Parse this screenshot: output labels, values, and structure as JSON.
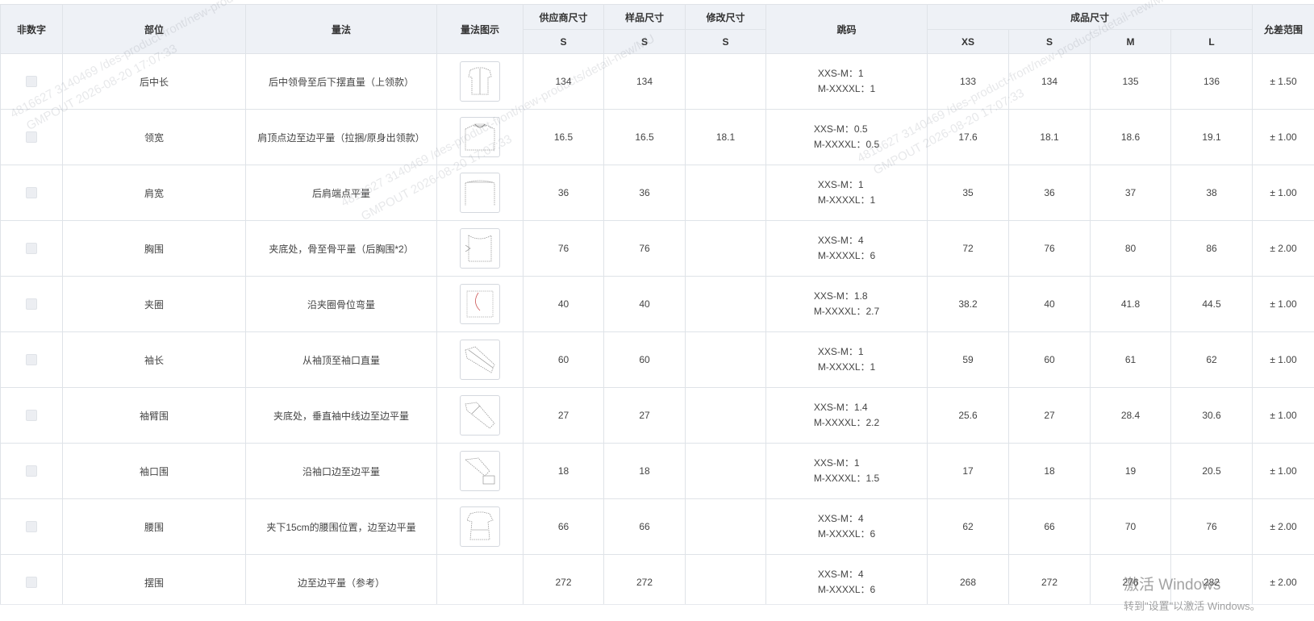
{
  "header": {
    "non_numeric": "非数字",
    "part": "部位",
    "method": "量法",
    "method_image": "量法图示",
    "supplier_size": "供应商尺寸",
    "sample_size": "样品尺寸",
    "modified_size": "修改尺寸",
    "grading": "跳码",
    "finished_size": "成品尺寸",
    "tolerance": "允差范围",
    "sub_supplier": "S",
    "sub_sample": "S",
    "sub_modified": "S",
    "sub_xs": "XS",
    "sub_s": "S",
    "sub_m": "M",
    "sub_l": "L"
  },
  "rows": [
    {
      "part": "后中长",
      "method": "后中领骨至后下摆直量（上领款）",
      "icon": "garment-back-length-icon",
      "supplier": "134",
      "sample": "134",
      "modified": "",
      "g1": "XXS-M：1",
      "g2": "M-XXXXL：1",
      "xs": "133",
      "s": "134",
      "m": "135",
      "l": "136",
      "tol": "± 1.50"
    },
    {
      "part": "领宽",
      "method": "肩顶点边至边平量（拉捆/原身出领款）",
      "icon": "garment-neck-width-icon",
      "supplier": "16.5",
      "sample": "16.5",
      "modified": "18.1",
      "g1": "XXS-M：0.5",
      "g2": "M-XXXXL：0.5",
      "xs": "17.6",
      "s": "18.1",
      "m": "18.6",
      "l": "19.1",
      "tol": "± 1.00"
    },
    {
      "part": "肩宽",
      "method": "后肩端点平量",
      "icon": "garment-shoulder-icon",
      "supplier": "36",
      "sample": "36",
      "modified": "",
      "g1": "XXS-M：1",
      "g2": "M-XXXXL：1",
      "xs": "35",
      "s": "36",
      "m": "37",
      "l": "38",
      "tol": "± 1.00"
    },
    {
      "part": "胸围",
      "method": "夹底处，骨至骨平量（后胸围*2）",
      "icon": "garment-chest-icon",
      "supplier": "76",
      "sample": "76",
      "modified": "",
      "g1": "XXS-M：4",
      "g2": "M-XXXXL：6",
      "xs": "72",
      "s": "76",
      "m": "80",
      "l": "86",
      "tol": "± 2.00"
    },
    {
      "part": "夹圈",
      "method": "沿夹圈骨位弯量",
      "icon": "garment-armhole-icon",
      "supplier": "40",
      "sample": "40",
      "modified": "",
      "g1": "XXS-M：1.8",
      "g2": "M-XXXXL：2.7",
      "xs": "38.2",
      "s": "40",
      "m": "41.8",
      "l": "44.5",
      "tol": "± 1.00"
    },
    {
      "part": "袖长",
      "method": "从袖顶至袖口直量",
      "icon": "garment-sleeve-length-icon",
      "supplier": "60",
      "sample": "60",
      "modified": "",
      "g1": "XXS-M：1",
      "g2": "M-XXXXL：1",
      "xs": "59",
      "s": "60",
      "m": "61",
      "l": "62",
      "tol": "± 1.00"
    },
    {
      "part": "袖臂围",
      "method": "夹底处，垂直袖中线边至边平量",
      "icon": "garment-bicep-icon",
      "supplier": "27",
      "sample": "27",
      "modified": "",
      "g1": "XXS-M：1.4",
      "g2": "M-XXXXL：2.2",
      "xs": "25.6",
      "s": "27",
      "m": "28.4",
      "l": "30.6",
      "tol": "± 1.00"
    },
    {
      "part": "袖口围",
      "method": "沿袖口边至边平量",
      "icon": "garment-cuff-icon",
      "supplier": "18",
      "sample": "18",
      "modified": "",
      "g1": "XXS-M：1",
      "g2": "M-XXXXL：1.5",
      "xs": "17",
      "s": "18",
      "m": "19",
      "l": "20.5",
      "tol": "± 1.00"
    },
    {
      "part": "腰围",
      "method": "夹下15cm的腰围位置，边至边平量",
      "icon": "garment-waist-icon",
      "supplier": "66",
      "sample": "66",
      "modified": "",
      "g1": "XXS-M：4",
      "g2": "M-XXXXL：6",
      "xs": "62",
      "s": "66",
      "m": "70",
      "l": "76",
      "tol": "± 2.00"
    },
    {
      "part": "摆围",
      "method": "边至边平量（参考）",
      "icon": "",
      "supplier": "272",
      "sample": "272",
      "modified": "",
      "g1": "XXS-M：4",
      "g2": "M-XXXXL：6",
      "xs": "268",
      "s": "272",
      "m": "276",
      "l": "282",
      "tol": "± 2.00"
    }
  ],
  "watermark": {
    "line1": "4816627 3140469 /des-product-front/new-products/detail-new/MU",
    "line2": "GMPOUT 2026-08-20 17:07:33"
  },
  "activation": {
    "title": "激活 Windows",
    "subtitle": "转到\"设置\"以激活 Windows。"
  },
  "colors": {
    "header_bg": "#eef1f6",
    "border": "#dfe3e8",
    "checkbox": "#eceef2"
  }
}
